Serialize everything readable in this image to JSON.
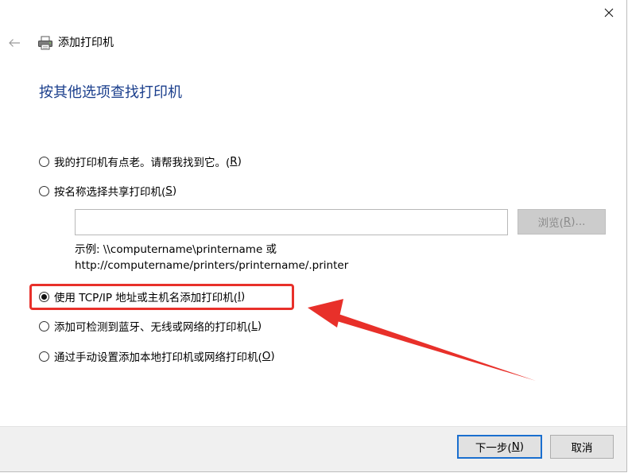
{
  "window": {
    "title": "添加打印机",
    "heading": "按其他选项查找打印机"
  },
  "icons": {
    "close": "close-icon",
    "back": "back-arrow-icon",
    "printer": "printer-icon"
  },
  "options": [
    {
      "label": "我的打印机有点老。请帮我找到它。(",
      "key": "R",
      "suffix": ")",
      "checked": false
    },
    {
      "label": "按名称选择共享打印机(",
      "key": "S",
      "suffix": ")",
      "checked": false
    },
    {
      "label": "使用 TCP/IP 地址或主机名添加打印机(",
      "key": "I",
      "suffix": ")",
      "checked": true
    },
    {
      "label": "添加可检测到蓝牙、无线或网络的打印机(",
      "key": "L",
      "suffix": ")",
      "checked": false
    },
    {
      "label": "通过手动设置添加本地打印机或网络打印机(",
      "key": "O",
      "suffix": ")",
      "checked": false
    }
  ],
  "share_input": {
    "value": "",
    "placeholder": ""
  },
  "browse_button": {
    "label": "浏览(",
    "key": "R",
    "suffix": ")..."
  },
  "example": {
    "line1": "示例: \\\\computername\\printername 或",
    "line2": "http://computername/printers/printername/.printer"
  },
  "footer": {
    "next_label": "下一步(",
    "next_key": "N",
    "next_suffix": ")",
    "cancel_label": "取消"
  },
  "colors": {
    "heading": "#1a3e8c",
    "highlight": "#e8302a",
    "primary_border": "#1a6fcf"
  }
}
